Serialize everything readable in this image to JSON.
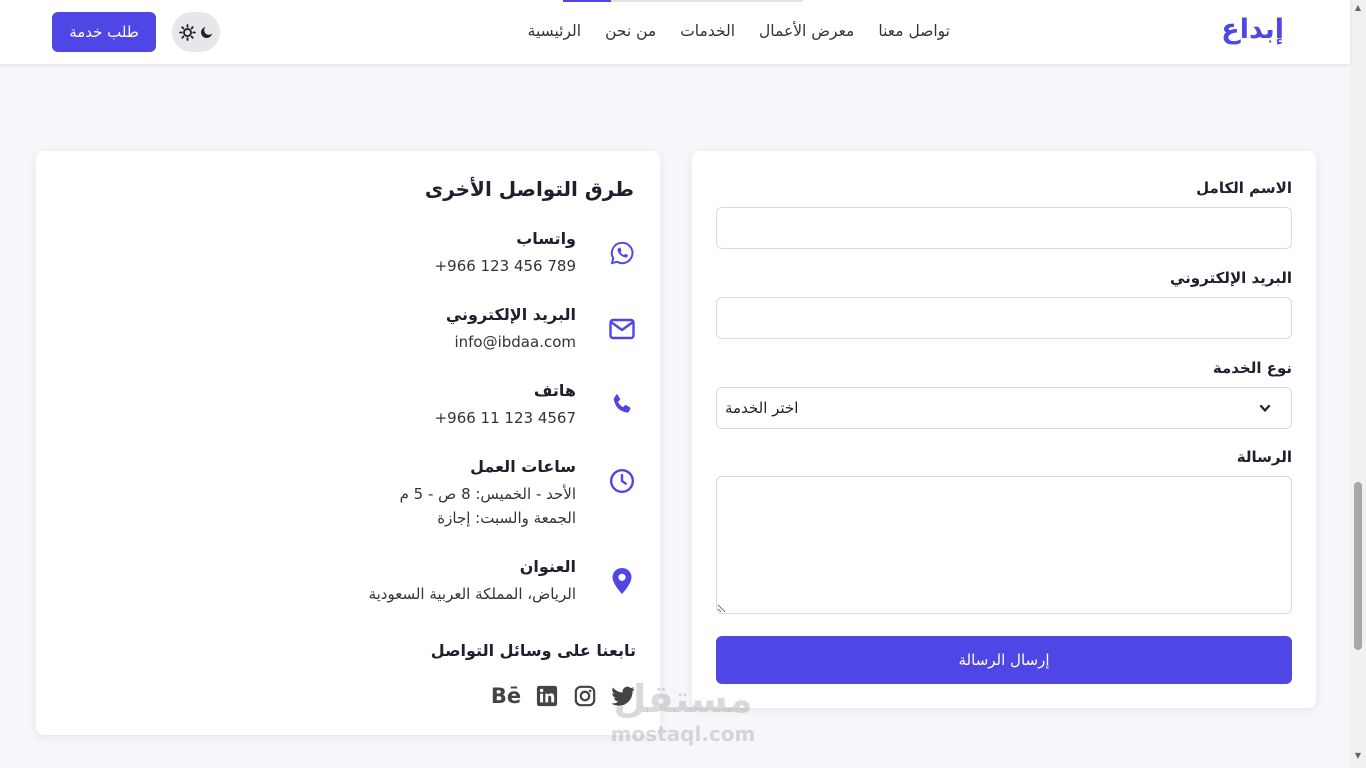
{
  "header": {
    "logo": "إبداع",
    "nav": [
      "الرئيسية",
      "من نحن",
      "الخدمات",
      "معرض الأعمال",
      "تواصل معنا"
    ],
    "cta_label": "طلب خدمة",
    "theme_toggle_icons": [
      "moon-icon",
      "sun-icon"
    ]
  },
  "info": {
    "title": "طرق التواصل الأخرى",
    "items": [
      {
        "icon": "whatsapp-icon",
        "label": "واتساب",
        "values": [
          "+966 123 456 789"
        ]
      },
      {
        "icon": "mail-icon",
        "label": "البريد الإلكتروني",
        "values": [
          "info@ibdaa.com"
        ]
      },
      {
        "icon": "phone-icon",
        "label": "هاتف",
        "values": [
          "+966 11 123 4567"
        ]
      },
      {
        "icon": "clock-icon",
        "label": "ساعات العمل",
        "values": [
          "الأحد - الخميس: 8 ص - 5 م",
          "الجمعة والسبت: إجازة"
        ]
      },
      {
        "icon": "location-pin-icon",
        "label": "العنوان",
        "values": [
          "الرياض، المملكة العربية السعودية"
        ]
      }
    ],
    "follow_title": "تابعنا على وسائل التواصل",
    "socials": [
      "twitter-icon",
      "instagram-icon",
      "linkedin-icon",
      "behance-icon"
    ],
    "behance_text": "Bē"
  },
  "form": {
    "name_label": "الاسم الكامل",
    "email_label": "البريد الإلكتروني",
    "service_label": "نوع الخدمة",
    "service_value": "اختر الخدمة",
    "message_label": "الرسالة",
    "submit_label": "إرسال الرسالة"
  },
  "watermark": {
    "main": "مستقل",
    "sub": "mostaql.com"
  },
  "colors": {
    "accent": "#4f46e5",
    "background": "#f6f7fb",
    "card": "#ffffff"
  }
}
